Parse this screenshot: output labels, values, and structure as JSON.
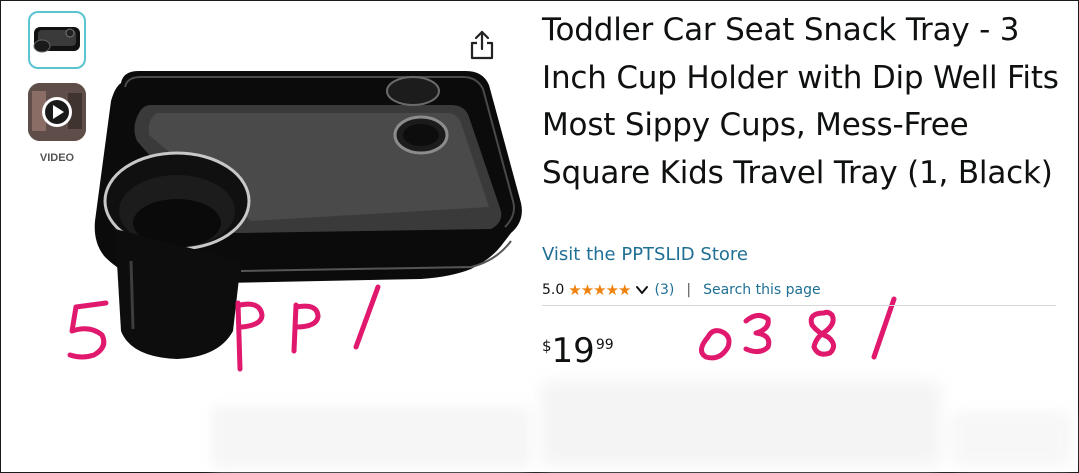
{
  "product": {
    "title": "Toddler Car Seat Snack Tray - 3 Inch Cup Holder with Dip Well Fits Most Sippy Cups, Mess-Free Square Kids Travel Tray (1, Black)",
    "store_link": "Visit the PPTSLID Store",
    "rating": {
      "value": "5.0",
      "stars": "★★★★★",
      "count": "(3)",
      "separator": "|",
      "search_link": "Search this page"
    },
    "price": {
      "symbol": "$",
      "whole": "19",
      "fraction": "99"
    }
  },
  "gallery": {
    "video_label": "VIDEO",
    "share_icon": "share-icon"
  },
  "annotations": {
    "left_note": "5 PPI",
    "right_note": "0381",
    "color": "#e0196e"
  },
  "colors": {
    "link": "#1f6f94",
    "stars": "#f0820f",
    "thumb_selected_border": "#5bc4d1"
  }
}
